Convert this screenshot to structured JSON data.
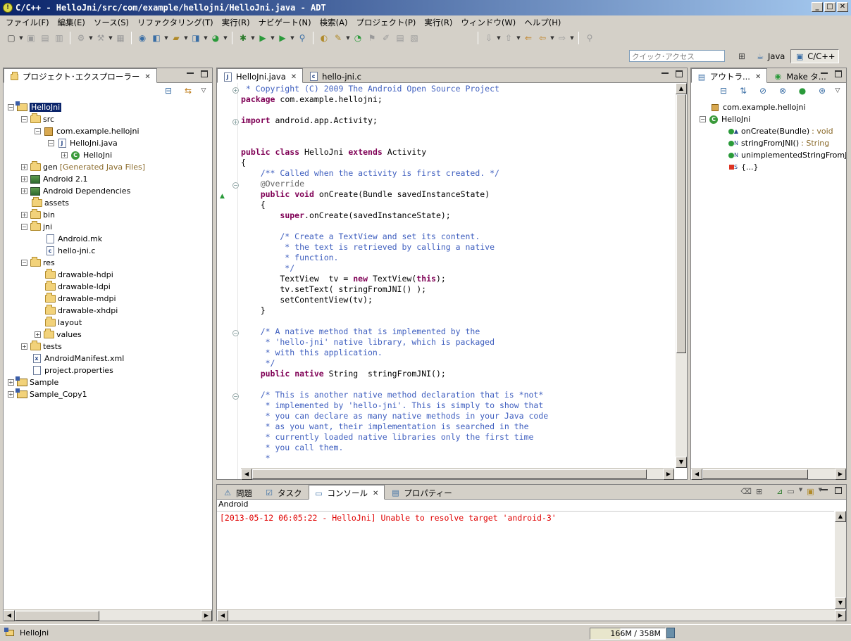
{
  "window": {
    "title": "C/C++ - HelloJni/src/com/example/hellojni/HelloJni.java - ADT",
    "minimize": "_",
    "maximize": "□",
    "close": "✕"
  },
  "menu": [
    "ファイル(F)",
    "編集(E)",
    "ソース(S)",
    "リファクタリング(T)",
    "実行(R)",
    "ナビゲート(N)",
    "検索(A)",
    "プロジェクト(P)",
    "実行(R)",
    "ウィンドウ(W)",
    "ヘルプ(H)"
  ],
  "quick_access": {
    "placeholder": "クイック･アクセス"
  },
  "perspectives": [
    {
      "label": "Java",
      "active": false
    },
    {
      "label": "C/C++",
      "active": true
    }
  ],
  "package_explorer": {
    "tab_label": "プロジェクト･エクスプローラー",
    "tree": [
      {
        "label": "HelloJni",
        "icon": "project-icon",
        "level": 0,
        "expander": "minus",
        "selected": true
      },
      {
        "label": "src",
        "icon": "folder-icon",
        "level": 1,
        "expander": "minus"
      },
      {
        "label": "com.example.hellojni",
        "icon": "package-icon",
        "level": 2,
        "expander": "minus"
      },
      {
        "label": "HelloJni.java",
        "icon": "java-file-icon",
        "level": 3,
        "expander": "minus"
      },
      {
        "label": "HelloJni",
        "icon": "class-icon",
        "level": 4,
        "expander": "plus"
      },
      {
        "label": "gen",
        "decorator": "[Generated Java Files]",
        "icon": "folder-icon",
        "level": 1,
        "expander": "plus"
      },
      {
        "label": "Android 2.1",
        "icon": "library-icon",
        "level": 1,
        "expander": "plus"
      },
      {
        "label": "Android Dependencies",
        "icon": "library-icon",
        "level": 1,
        "expander": "plus"
      },
      {
        "label": "assets",
        "icon": "folder-icon",
        "level": 1,
        "expander": "none"
      },
      {
        "label": "bin",
        "icon": "folder-icon",
        "level": 1,
        "expander": "plus"
      },
      {
        "label": "jni",
        "icon": "folder-icon",
        "level": 1,
        "expander": "minus"
      },
      {
        "label": "Android.mk",
        "icon": "file-icon",
        "level": 2,
        "expander": "none"
      },
      {
        "label": "hello-jni.c",
        "icon": "c-file-icon",
        "level": 2,
        "expander": "none"
      },
      {
        "label": "res",
        "icon": "folder-icon",
        "level": 1,
        "expander": "minus"
      },
      {
        "label": "drawable-hdpi",
        "icon": "folder-icon",
        "level": 2,
        "expander": "none"
      },
      {
        "label": "drawable-ldpi",
        "icon": "folder-icon",
        "level": 2,
        "expander": "none"
      },
      {
        "label": "drawable-mdpi",
        "icon": "folder-icon",
        "level": 2,
        "expander": "none"
      },
      {
        "label": "drawable-xhdpi",
        "icon": "folder-icon",
        "level": 2,
        "expander": "none"
      },
      {
        "label": "layout",
        "icon": "folder-icon",
        "level": 2,
        "expander": "none"
      },
      {
        "label": "values",
        "icon": "folder-icon",
        "level": 2,
        "expander": "plus"
      },
      {
        "label": "tests",
        "icon": "folder-icon",
        "level": 1,
        "expander": "plus"
      },
      {
        "label": "AndroidManifest.xml",
        "icon": "xml-file-icon",
        "level": 1,
        "expander": "none"
      },
      {
        "label": "project.properties",
        "icon": "file-icon",
        "level": 1,
        "expander": "none"
      },
      {
        "label": "Sample",
        "icon": "project-icon",
        "level": 0,
        "expander": "plus"
      },
      {
        "label": "Sample_Copy1",
        "icon": "project-icon",
        "level": 0,
        "expander": "plus"
      }
    ]
  },
  "editor": {
    "tabs": [
      {
        "label": "HelloJni.java",
        "active": true
      },
      {
        "label": "hello-jni.c",
        "active": false
      }
    ],
    "lines": [
      [
        {
          "t": " * Copyright (C) 2009 The Android Open Source Project",
          "c": "cm"
        }
      ],
      [
        {
          "t": "package",
          "c": "kw"
        },
        {
          "t": " com.example.hellojni;",
          "c": "plain"
        }
      ],
      [],
      [
        {
          "t": "import",
          "c": "kw"
        },
        {
          "t": " android.app.Activity;",
          "c": "plain"
        }
      ],
      [],
      [],
      [
        {
          "t": "public",
          "c": "kw"
        },
        {
          "t": " ",
          "c": "plain"
        },
        {
          "t": "class",
          "c": "kw"
        },
        {
          "t": " HelloJni ",
          "c": "plain"
        },
        {
          "t": "extends",
          "c": "kw"
        },
        {
          "t": " Activity",
          "c": "plain"
        }
      ],
      [
        {
          "t": "{",
          "c": "plain"
        }
      ],
      [
        {
          "t": "    /** Called when the activity is first created. */",
          "c": "cm"
        }
      ],
      [
        {
          "t": "    @Override",
          "c": "ann"
        }
      ],
      [
        {
          "t": "    ",
          "c": "plain"
        },
        {
          "t": "public",
          "c": "kw"
        },
        {
          "t": " ",
          "c": "plain"
        },
        {
          "t": "void",
          "c": "kw"
        },
        {
          "t": " onCreate(Bundle savedInstanceState)",
          "c": "plain"
        }
      ],
      [
        {
          "t": "    {",
          "c": "plain"
        }
      ],
      [
        {
          "t": "        ",
          "c": "plain"
        },
        {
          "t": "super",
          "c": "kw"
        },
        {
          "t": ".onCreate(savedInstanceState);",
          "c": "plain"
        }
      ],
      [],
      [
        {
          "t": "        /* Create a TextView and set its content.",
          "c": "cm"
        }
      ],
      [
        {
          "t": "         * the text is retrieved by calling a native",
          "c": "cm"
        }
      ],
      [
        {
          "t": "         * function.",
          "c": "cm"
        }
      ],
      [
        {
          "t": "         */",
          "c": "cm"
        }
      ],
      [
        {
          "t": "        TextView  tv = ",
          "c": "plain"
        },
        {
          "t": "new",
          "c": "kw"
        },
        {
          "t": " TextView(",
          "c": "plain"
        },
        {
          "t": "this",
          "c": "kw"
        },
        {
          "t": ");",
          "c": "plain"
        }
      ],
      [
        {
          "t": "        tv.setText( stringFromJNI() );",
          "c": "plain"
        }
      ],
      [
        {
          "t": "        setContentView(tv);",
          "c": "plain"
        }
      ],
      [
        {
          "t": "    }",
          "c": "plain"
        }
      ],
      [],
      [
        {
          "t": "    /* A native method that is implemented by the",
          "c": "cm"
        }
      ],
      [
        {
          "t": "     * 'hello-jni' native library, which is packaged",
          "c": "cm"
        }
      ],
      [
        {
          "t": "     * with this application.",
          "c": "cm"
        }
      ],
      [
        {
          "t": "     */",
          "c": "cm"
        }
      ],
      [
        {
          "t": "    ",
          "c": "plain"
        },
        {
          "t": "public",
          "c": "kw"
        },
        {
          "t": " ",
          "c": "plain"
        },
        {
          "t": "native",
          "c": "kw"
        },
        {
          "t": " String  stringFromJNI();",
          "c": "plain"
        }
      ],
      [],
      [
        {
          "t": "    /* This is another native method declaration that is *not*",
          "c": "cm"
        }
      ],
      [
        {
          "t": "     * implemented by 'hello-jni'. This is simply to show that",
          "c": "cm"
        }
      ],
      [
        {
          "t": "     * you can declare as many native methods in your Java code",
          "c": "cm"
        }
      ],
      [
        {
          "t": "     * as you want, their implementation is searched in the",
          "c": "cm"
        }
      ],
      [
        {
          "t": "     * currently loaded native libraries only the first time",
          "c": "cm"
        }
      ],
      [
        {
          "t": "     * you call them.",
          "c": "cm"
        }
      ],
      [
        {
          "t": "     *",
          "c": "cm"
        }
      ]
    ]
  },
  "outline": {
    "tabs": [
      {
        "label": "アウトラ...",
        "active": true
      },
      {
        "label": "Make タ...",
        "active": false
      }
    ],
    "items": [
      {
        "label": "com.example.hellojni",
        "suffix": "",
        "icon": "package-icon",
        "level": 0
      },
      {
        "label": "HelloJni",
        "suffix": "",
        "icon": "class-icon",
        "level": 0,
        "expander": "minus"
      },
      {
        "label": "onCreate(Bundle)",
        "suffix": " : void",
        "icon": "public-method-icon",
        "marker": "▲",
        "level": 1
      },
      {
        "label": "stringFromJNI()",
        "suffix": " : String",
        "icon": "native-method-icon",
        "marker": "N",
        "level": 1
      },
      {
        "label": "unimplementedStringFromJ",
        "suffix": "",
        "icon": "native-method-icon",
        "marker": "N",
        "level": 1
      },
      {
        "label": "{...}",
        "suffix": "",
        "icon": "static-block-icon",
        "marker": "S",
        "level": 1
      }
    ]
  },
  "bottom_panel": {
    "tabs": [
      {
        "label": "問題",
        "active": false
      },
      {
        "label": "タスク",
        "active": false
      },
      {
        "label": "コンソール",
        "active": true
      },
      {
        "label": "プロパティー",
        "active": false
      }
    ],
    "console_name": "Android",
    "console_lines": [
      "[2013-05-12 06:05:22 - HelloJni] Unable to resolve target 'android-3'"
    ]
  },
  "status": {
    "selection": "HelloJni",
    "memory": "166M / 358M"
  }
}
